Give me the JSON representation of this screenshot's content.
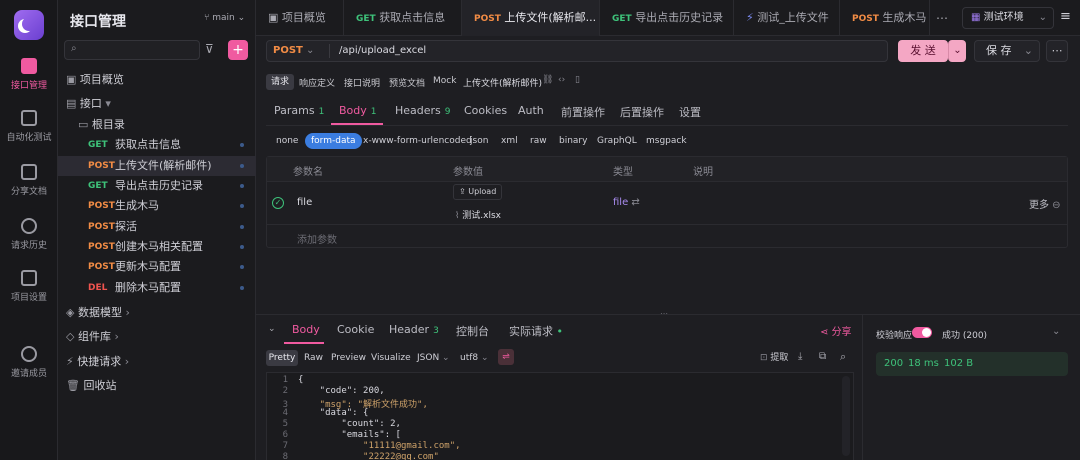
{
  "app": {
    "title": "接口管理",
    "branch": "main",
    "accent": "#f05aa0"
  },
  "rail": {
    "items": [
      {
        "label": "接口管理",
        "icon": "api-icon"
      },
      {
        "label": "自动化测试",
        "icon": "automation-icon"
      },
      {
        "label": "分享文档",
        "icon": "share-doc-icon"
      },
      {
        "label": "请求历史",
        "icon": "history-icon"
      },
      {
        "label": "项目设置",
        "icon": "settings-icon"
      },
      {
        "label": "邀请成员",
        "icon": "invite-icon"
      }
    ]
  },
  "sidebar": {
    "overview": "项目概览",
    "api_group": "接口",
    "root": "根目录",
    "endpoints": [
      {
        "method": "GET",
        "name": "获取点击信息"
      },
      {
        "method": "POST",
        "name": "上传文件(解析邮件)"
      },
      {
        "method": "GET",
        "name": "导出点击历史记录"
      },
      {
        "method": "POST",
        "name": "生成木马"
      },
      {
        "method": "POST",
        "name": "探活"
      },
      {
        "method": "POST",
        "name": "创建木马相关配置"
      },
      {
        "method": "POST",
        "name": "更新木马配置"
      },
      {
        "method": "DEL",
        "name": "删除木马配置"
      }
    ],
    "groups": [
      "数据模型",
      "组件库",
      "快捷请求",
      "回收站"
    ]
  },
  "tabs": [
    {
      "method": "",
      "label": "项目概览"
    },
    {
      "method": "GET",
      "label": "获取点击信息"
    },
    {
      "method": "POST",
      "label": "上传文件(解析邮..."
    },
    {
      "method": "GET",
      "label": "导出点击历史记录"
    },
    {
      "method": "",
      "label": "测试_上传文件"
    },
    {
      "method": "POST",
      "label": "生成木马"
    }
  ],
  "env": "测试环境",
  "request": {
    "method": "POST",
    "url": "/api/upload_excel",
    "send_label": "发 送",
    "save_label": "保 存",
    "mode_tabs": [
      "请求",
      "响应定义",
      "接口说明",
      "预览文档",
      "Mock"
    ],
    "api_name": "上传文件(解析邮件)",
    "sub_tabs": [
      {
        "label": "Params",
        "count": "1"
      },
      {
        "label": "Body",
        "count": "1"
      },
      {
        "label": "Headers",
        "count": "9"
      },
      {
        "label": "Cookies",
        "count": ""
      },
      {
        "label": "Auth",
        "count": ""
      },
      {
        "label": "前置操作",
        "count": ""
      },
      {
        "label": "后置操作",
        "count": ""
      },
      {
        "label": "设置",
        "count": ""
      }
    ],
    "body_types": [
      "none",
      "form-data",
      "x-www-form-urlencoded",
      "json",
      "xml",
      "raw",
      "binary",
      "GraphQL",
      "msgpack"
    ],
    "table_headers": [
      "参数名",
      "参数值",
      "类型",
      "说明"
    ],
    "param": {
      "name": "file",
      "upload_label": "Upload",
      "file_name": "测试.xlsx",
      "type": "file",
      "more_label": "更多"
    },
    "add_param": "添加参数"
  },
  "response": {
    "tabs": [
      {
        "label": "Body",
        "count": ""
      },
      {
        "label": "Cookie",
        "count": ""
      },
      {
        "label": "Header",
        "count": "3"
      },
      {
        "label": "控制台",
        "count": ""
      },
      {
        "label": "实际请求",
        "count": ""
      }
    ],
    "share_label": "分享",
    "view_modes": [
      "Pretty",
      "Raw",
      "Preview",
      "Visualize"
    ],
    "format": "JSON",
    "encoding": "utf8",
    "extract_label": "提取",
    "validate_label": "校验响应",
    "success_label": "成功 (200)",
    "status": "200",
    "time": "18 ms",
    "size": "102 B",
    "code_lines": [
      "{",
      "    \"code\": 200,",
      "    \"msg\": \"解析文件成功\",",
      "    \"data\": {",
      "        \"count\": 2,",
      "        \"emails\": [",
      "            \"11111@gmail.com\",",
      "            \"22222@qq.com\""
    ]
  }
}
